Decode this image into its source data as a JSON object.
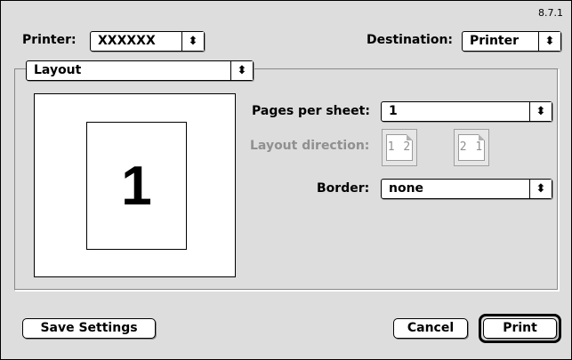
{
  "version": "8.7.1",
  "printer": {
    "label": "Printer:",
    "value": "XXXXXX"
  },
  "destination": {
    "label": "Destination:",
    "value": "Printer"
  },
  "panel_menu": {
    "value": "Layout"
  },
  "preview": {
    "page_number": "1"
  },
  "layout": {
    "pages_per_sheet_label": "Pages per sheet:",
    "pages_per_sheet_value": "1",
    "direction_label": "Layout direction:",
    "direction_options": [
      {
        "text": "1 2",
        "name": "left-to-right"
      },
      {
        "text": "2 1",
        "name": "right-to-left"
      }
    ],
    "border_label": "Border:",
    "border_value": "none"
  },
  "buttons": {
    "save_settings": "Save Settings",
    "cancel": "Cancel",
    "print": "Print"
  },
  "icons": {
    "popup_arrow": "up-down-arrows-icon"
  }
}
